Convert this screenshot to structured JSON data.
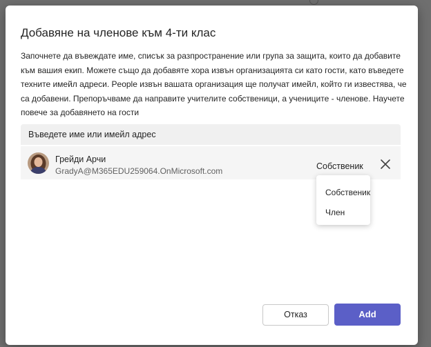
{
  "dialog": {
    "title": "Добавяне на членове към 4-ти клас",
    "description": "Започнете да въвеждате име, списък за разпространение или група за защита, които да добавите към вашия екип. Можете също да добавяте хора извън организацията си като гости, като въведете техните имейл адреси. People извън вашата организация ще получат имейл, който ги известява, че са добавени. Препоръчваме да направите учителите собственици, а учениците - членове. Научете повече за добавянето на гости",
    "search": {
      "placeholder": "Въведете име или имейл адрес"
    },
    "member": {
      "name": "Грейди Арчи",
      "email": "GradyA@M365EDU259064.OnMicrosoft.com",
      "role": "Собственик"
    },
    "role_menu": {
      "options": [
        "Собственик",
        "Член"
      ]
    },
    "buttons": {
      "cancel": "Отказ",
      "add": "Add"
    }
  },
  "colors": {
    "accent": "#5b5fc7",
    "backdrop": "#7a7a7a"
  }
}
